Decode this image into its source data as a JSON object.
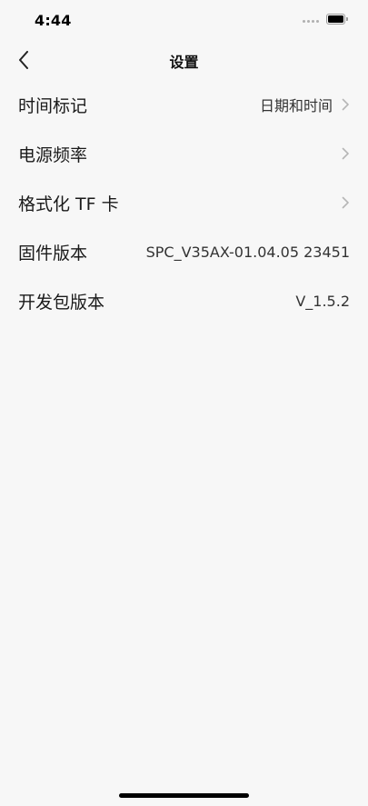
{
  "status_bar": {
    "time": "4:44"
  },
  "nav": {
    "title": "设置",
    "back_icon": "chevron-left-icon"
  },
  "settings": {
    "rows": [
      {
        "label": "时间标记",
        "value": "日期和时间",
        "has_chevron": true
      },
      {
        "label": "电源频率",
        "value": "",
        "has_chevron": true
      },
      {
        "label": "格式化 TF 卡",
        "value": "",
        "has_chevron": true
      },
      {
        "label": "固件版本",
        "value": "SPC_V35AX-01.04.05 23451",
        "has_chevron": false
      },
      {
        "label": "开发包版本",
        "value": "V_1.5.2",
        "has_chevron": false
      }
    ]
  },
  "colors": {
    "background": "#f7f7f7",
    "text": "#1a1a1a",
    "chevron": "#b5b5b5"
  }
}
